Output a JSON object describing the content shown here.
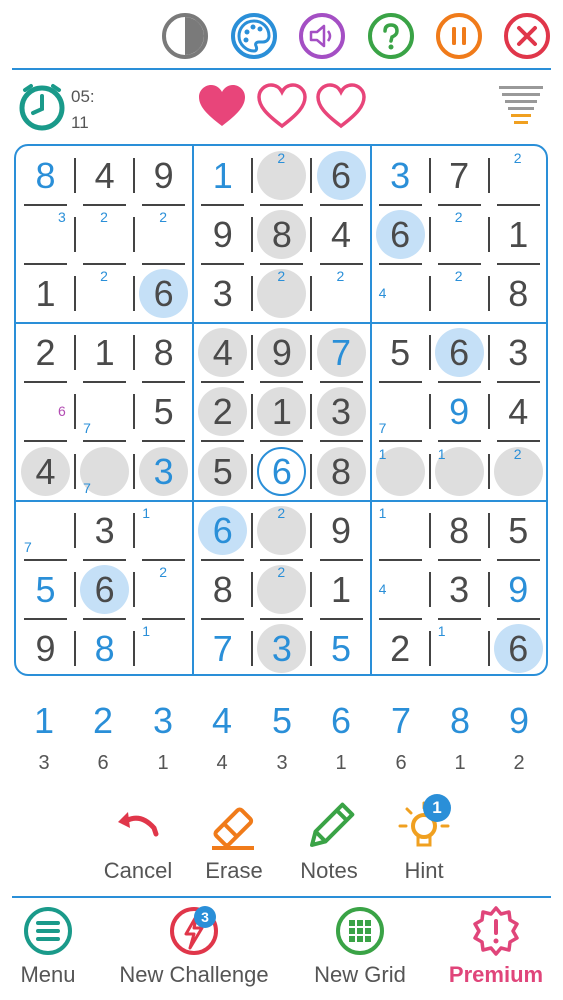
{
  "toolbar": {
    "icons": [
      "contrast-icon",
      "palette-icon",
      "sound-icon",
      "help-icon",
      "pause-icon",
      "close-icon"
    ],
    "colors": {
      "contrast": "#7a7a7a",
      "palette": "#2a8fd8",
      "sound": "#a44fc4",
      "help": "#3aa346",
      "pause": "#f07b1a",
      "close": "#e0364a"
    }
  },
  "status": {
    "time_minutes": "05:",
    "time_seconds": "11",
    "lives_total": 3,
    "lives_filled": 1
  },
  "board": {
    "given_color": "#4a4a4a",
    "user_color": "#2a8fd8",
    "cells": [
      [
        {
          "v": "8",
          "t": "user"
        },
        {
          "v": "4",
          "t": "given"
        },
        {
          "v": "9",
          "t": "given"
        },
        {
          "v": "1",
          "t": "user"
        },
        {
          "v": "",
          "hl": "grey",
          "notes": "2"
        },
        {
          "v": "6",
          "t": "given",
          "hl": "blue"
        },
        {
          "v": "3",
          "t": "user"
        },
        {
          "v": "7",
          "t": "given"
        },
        {
          "v": "",
          "notes": "2"
        }
      ],
      [
        {
          "v": "",
          "notes": "3"
        },
        {
          "v": "",
          "notes": "2"
        },
        {
          "v": "",
          "notes": "2"
        },
        {
          "v": "9",
          "t": "given"
        },
        {
          "v": "8",
          "t": "given",
          "hl": "grey"
        },
        {
          "v": "4",
          "t": "given"
        },
        {
          "v": "6",
          "t": "given",
          "hl": "blue"
        },
        {
          "v": "",
          "notes": "2"
        },
        {
          "v": "1",
          "t": "given"
        }
      ],
      [
        {
          "v": "1",
          "t": "given"
        },
        {
          "v": "",
          "notes": "2"
        },
        {
          "v": "6",
          "t": "given",
          "hl": "blue"
        },
        {
          "v": "3",
          "t": "given"
        },
        {
          "v": "",
          "hl": "grey",
          "notes": "2"
        },
        {
          "v": "",
          "notes": "2"
        },
        {
          "v": "",
          "notes": "4"
        },
        {
          "v": "",
          "notes": "2"
        },
        {
          "v": "8",
          "t": "given"
        }
      ],
      [
        {
          "v": "2",
          "t": "given"
        },
        {
          "v": "1",
          "t": "given"
        },
        {
          "v": "8",
          "t": "given"
        },
        {
          "v": "4",
          "t": "given",
          "hl": "grey"
        },
        {
          "v": "9",
          "t": "given",
          "hl": "grey"
        },
        {
          "v": "7",
          "t": "user",
          "hl": "grey"
        },
        {
          "v": "5",
          "t": "given"
        },
        {
          "v": "6",
          "t": "given",
          "hl": "blue"
        },
        {
          "v": "3",
          "t": "given"
        }
      ],
      [
        {
          "v": "",
          "notes": "6",
          "purple": true
        },
        {
          "v": "",
          "notes": "7"
        },
        {
          "v": "5",
          "t": "given"
        },
        {
          "v": "2",
          "t": "given",
          "hl": "grey"
        },
        {
          "v": "1",
          "t": "given",
          "hl": "grey"
        },
        {
          "v": "3",
          "t": "given",
          "hl": "grey"
        },
        {
          "v": "",
          "notes": "7"
        },
        {
          "v": "9",
          "t": "user"
        },
        {
          "v": "4",
          "t": "given"
        }
      ],
      [
        {
          "v": "4",
          "t": "given",
          "hl": "grey"
        },
        {
          "v": "",
          "hl": "grey",
          "notes": "7"
        },
        {
          "v": "3",
          "t": "user",
          "hl": "grey"
        },
        {
          "v": "5",
          "t": "given",
          "hl": "grey"
        },
        {
          "v": "6",
          "t": "user",
          "hl": "ring"
        },
        {
          "v": "8",
          "t": "given",
          "hl": "grey"
        },
        {
          "v": "",
          "hl": "grey",
          "notes": "1"
        },
        {
          "v": "",
          "hl": "grey",
          "notes": "1"
        },
        {
          "v": "",
          "hl": "grey",
          "notes": "2"
        }
      ],
      [
        {
          "v": "",
          "notes": "7"
        },
        {
          "v": "3",
          "t": "given"
        },
        {
          "v": "",
          "notes": "1"
        },
        {
          "v": "6",
          "t": "user",
          "hl": "blue"
        },
        {
          "v": "",
          "hl": "grey",
          "notes": "2"
        },
        {
          "v": "9",
          "t": "given"
        },
        {
          "v": "",
          "notes": "1"
        },
        {
          "v": "8",
          "t": "given"
        },
        {
          "v": "5",
          "t": "given"
        }
      ],
      [
        {
          "v": "5",
          "t": "user"
        },
        {
          "v": "6",
          "t": "given",
          "hl": "blue"
        },
        {
          "v": "",
          "notes": "2"
        },
        {
          "v": "8",
          "t": "given"
        },
        {
          "v": "",
          "hl": "grey",
          "notes": "2"
        },
        {
          "v": "1",
          "t": "given"
        },
        {
          "v": "",
          "notes": "4"
        },
        {
          "v": "3",
          "t": "given"
        },
        {
          "v": "9",
          "t": "user"
        }
      ],
      [
        {
          "v": "9",
          "t": "given"
        },
        {
          "v": "8",
          "t": "user"
        },
        {
          "v": "",
          "notes": "1"
        },
        {
          "v": "7",
          "t": "user"
        },
        {
          "v": "3",
          "t": "user",
          "hl": "grey"
        },
        {
          "v": "5",
          "t": "user"
        },
        {
          "v": "2",
          "t": "given"
        },
        {
          "v": "",
          "notes": "1"
        },
        {
          "v": "6",
          "t": "given",
          "hl": "blue"
        }
      ]
    ]
  },
  "number_pad": {
    "numbers": [
      "1",
      "2",
      "3",
      "4",
      "5",
      "6",
      "7",
      "8",
      "9"
    ],
    "counts": [
      "3",
      "6",
      "1",
      "4",
      "3",
      "1",
      "6",
      "1",
      "2"
    ]
  },
  "actions": {
    "cancel": "Cancel",
    "erase": "Erase",
    "notes": "Notes",
    "hint": "Hint",
    "hint_badge": "1"
  },
  "nav": {
    "menu": "Menu",
    "new_challenge": "New Challenge",
    "new_challenge_badge": "3",
    "new_grid": "New Grid",
    "premium": "Premium"
  }
}
